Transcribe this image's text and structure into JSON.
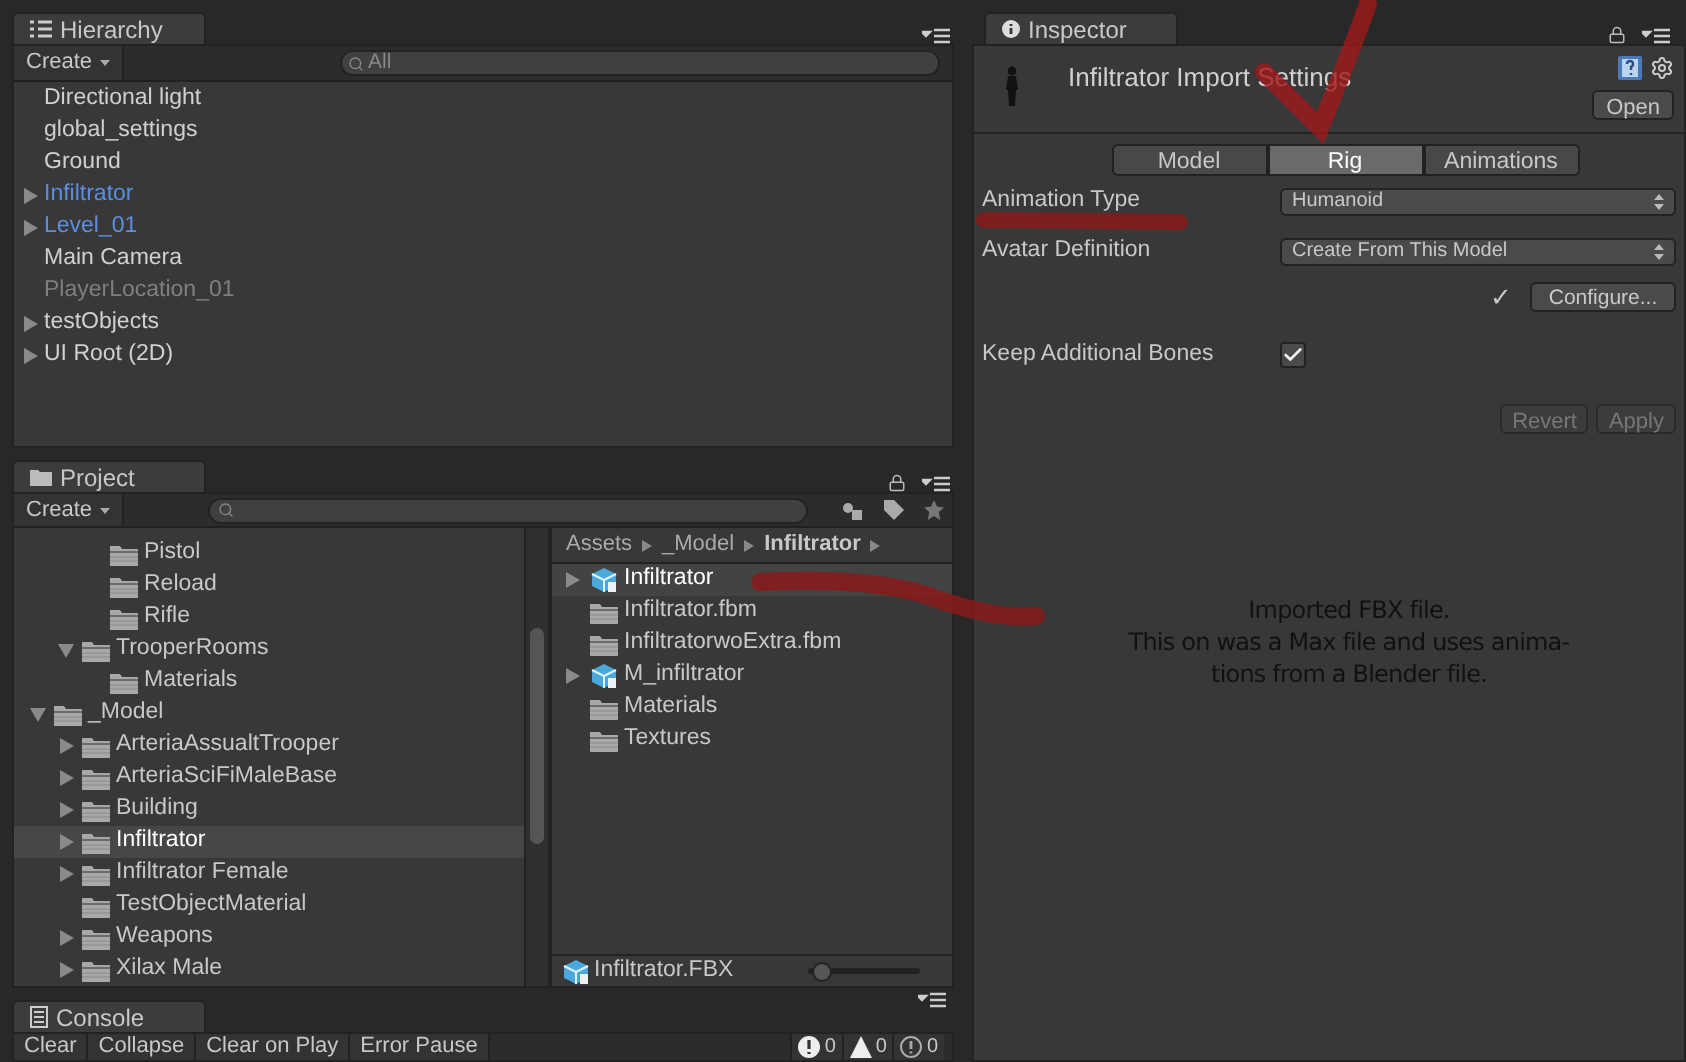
{
  "hierarchy": {
    "tab": "Hierarchy",
    "create": "Create",
    "search_placeholder": "All",
    "items": [
      {
        "label": "Directional light",
        "kind": "normal"
      },
      {
        "label": "global_settings",
        "kind": "normal"
      },
      {
        "label": "Ground",
        "kind": "normal"
      },
      {
        "label": "Infiltrator",
        "kind": "prefab",
        "expanded": false
      },
      {
        "label": "Level_01",
        "kind": "prefab",
        "expanded": false
      },
      {
        "label": "Main Camera",
        "kind": "normal"
      },
      {
        "label": "PlayerLocation_01",
        "kind": "inactive"
      },
      {
        "label": "testObjects",
        "kind": "normal",
        "expanded": false
      },
      {
        "label": "UI Root (2D)",
        "kind": "normal",
        "expanded": false
      }
    ]
  },
  "project": {
    "tab": "Project",
    "create": "Create",
    "tree": [
      {
        "children": [
          {
            "children": [
              {
                "label": "Pistol",
                "selected": false
              },
              {
                "label": "Reload",
                "selected": false
              },
              {
                "label": "Rifle",
                "selected": false
              }
            ]
          },
          {
            "label": "TrooperRooms",
            "selected": false,
            "expanded": true,
            "children": [
              {
                "label": "Materials",
                "selected": false
              }
            ]
          }
        ]
      },
      {
        "label": "_Model",
        "selected": false,
        "expanded": true,
        "children": [
          {
            "label": "ArteriaAssualtTrooper",
            "selected": false,
            "expanded": false
          },
          {
            "label": "ArteriaSciFiMaleBase",
            "selected": false,
            "expanded": false
          },
          {
            "label": "Building",
            "selected": false,
            "expanded": false
          },
          {
            "label": "Infiltrator",
            "selected": true,
            "expanded": false
          },
          {
            "label": "Infiltrator Female",
            "selected": false,
            "expanded": false
          },
          {
            "label": "TestObjectMaterial",
            "selected": false
          },
          {
            "label": "Weapons",
            "selected": false,
            "expanded": false
          },
          {
            "label": "Xilax Male",
            "selected": false,
            "expanded": false
          }
        ]
      }
    ],
    "breadcrumb": [
      "Assets",
      "_Model",
      "Infiltrator"
    ],
    "files": [
      {
        "label": "Infiltrator",
        "kind": "model",
        "expanded": false,
        "selected": true
      },
      {
        "label": "Infiltrator.fbm",
        "kind": "folder",
        "selected": false
      },
      {
        "label": "InfiltratorwoExtra.fbm",
        "kind": "folder",
        "selected": false
      },
      {
        "label": "M_infiltrator",
        "kind": "model",
        "expanded": false,
        "selected": false
      },
      {
        "label": "Materials",
        "kind": "folder",
        "selected": false
      },
      {
        "label": "Textures",
        "kind": "folder",
        "selected": false
      }
    ],
    "selected_file": "Infiltrator.FBX",
    "zoom": {
      "level": 0.05
    }
  },
  "console": {
    "tab": "Console",
    "buttons": [
      "Clear",
      "Collapse",
      "Clear on Play",
      "Error Pause"
    ],
    "counts": [
      {
        "kind": "error",
        "value": "0"
      },
      {
        "kind": "warning",
        "value": "0"
      },
      {
        "kind": "info",
        "value": "0"
      }
    ]
  },
  "inspector": {
    "tab": "Inspector",
    "title": "Infiltrator Import Settings",
    "open": "Open",
    "tabs": [
      {
        "label": "Model",
        "selected": false
      },
      {
        "label": "Rig",
        "selected": true
      },
      {
        "label": "Animations",
        "selected": false
      }
    ],
    "animation_type": {
      "label": "Animation Type",
      "value": "Humanoid"
    },
    "avatar_definition": {
      "label": "Avatar Definition",
      "value": "Create From This Model"
    },
    "configure": {
      "mark": "✓",
      "label": "Configure..."
    },
    "keep_bones": {
      "label": "Keep Additional Bones",
      "checked": true
    },
    "buttons": [
      {
        "label": "Revert",
        "disabled": true
      },
      {
        "label": "Apply",
        "disabled": true
      }
    ]
  },
  "note": [
    "Imported FBX file.",
    "This on was a Max file and uses anima-",
    "tions from a Blender file."
  ]
}
